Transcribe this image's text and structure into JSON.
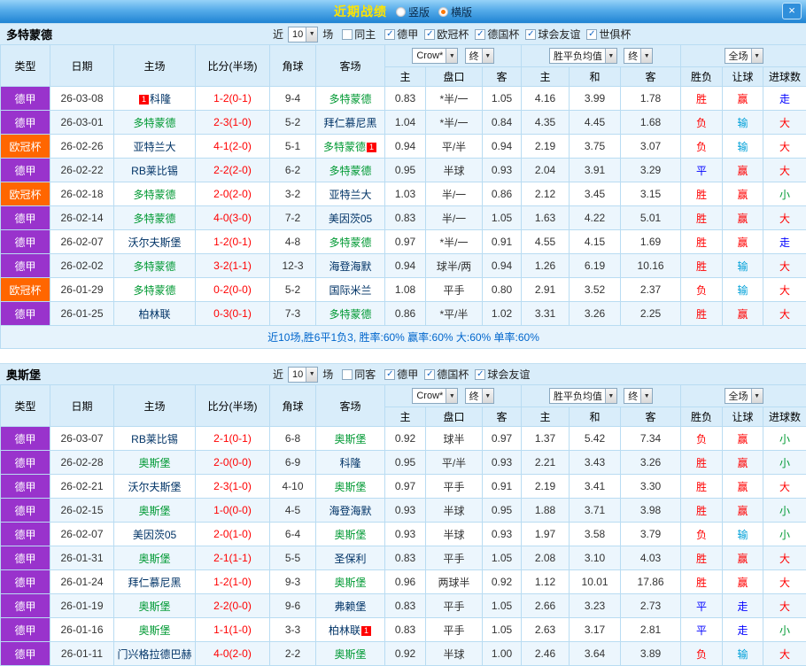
{
  "titlebar": {
    "title": "近期战绩",
    "radio_vertical": "竖版",
    "radio_horizontal": "横版",
    "close_label": "×"
  },
  "labels": {
    "near": "近",
    "games": "场"
  },
  "headers": {
    "type": "类型",
    "date": "日期",
    "home": "主场",
    "score": "比分(半场)",
    "corner": "角球",
    "away": "客场",
    "odds_home": "主",
    "odds_line": "盘口",
    "odds_away": "客",
    "ep_home": "主",
    "ep_draw": "和",
    "ep_away": "客",
    "wdl": "胜负",
    "handicap": "让球",
    "goals": "进球数",
    "company_select": "Crow*",
    "final_select": "终",
    "europe_select": "胜平负均值",
    "scope_select": "全场"
  },
  "league_colors": {
    "德甲": "#9933cc",
    "欧冠杯": "#ff6600"
  },
  "team_colors": {
    "self": "#009933",
    "opponent": "#003366"
  },
  "result_colors": {
    "胜": "#ff0000",
    "平": "#0000ff",
    "负": "#ff0000",
    "赢": "#ff0000",
    "输": "#00a0d8",
    "走": "#0000ff",
    "大": "#ff0000",
    "小": "#009933"
  },
  "sections": [
    {
      "team": "多特蒙德",
      "filter": {
        "count": "10",
        "same_label": "同主",
        "same_checked": false,
        "leagues": [
          "德甲",
          "欧冠杯",
          "德国杯",
          "球会友谊",
          "世俱杯"
        ]
      },
      "summary": "近10场,胜6平1负3, 胜率:60% 赢率:60% 大:60% 单率:60%",
      "rows": [
        {
          "league": "德甲",
          "date": "26-03-08",
          "home": {
            "name": "科隆",
            "self": false,
            "badge": "1",
            "badge_pos": "before"
          },
          "score": "1-2(0-1)",
          "corner": "9-4",
          "away": {
            "name": "多特蒙德",
            "self": true
          },
          "handicap": [
            "0.83",
            "*半/一",
            "1.05"
          ],
          "europe": [
            "4.16",
            "3.99",
            "1.78"
          ],
          "results": [
            "胜",
            "赢",
            "走"
          ]
        },
        {
          "league": "德甲",
          "date": "26-03-01",
          "home": {
            "name": "多特蒙德",
            "self": true
          },
          "score": "2-3(1-0)",
          "corner": "5-2",
          "away": {
            "name": "拜仁慕尼黑",
            "self": false
          },
          "handicap": [
            "1.04",
            "*半/一",
            "0.84"
          ],
          "europe": [
            "4.35",
            "4.45",
            "1.68"
          ],
          "results": [
            "负",
            "输",
            "大"
          ]
        },
        {
          "league": "欧冠杯",
          "date": "26-02-26",
          "home": {
            "name": "亚特兰大",
            "self": false
          },
          "score": "4-1(2-0)",
          "corner": "5-1",
          "away": {
            "name": "多特蒙德",
            "self": true,
            "badge": "1",
            "badge_pos": "after"
          },
          "handicap": [
            "0.94",
            "平/半",
            "0.94"
          ],
          "europe": [
            "2.19",
            "3.75",
            "3.07"
          ],
          "results": [
            "负",
            "输",
            "大"
          ]
        },
        {
          "league": "德甲",
          "date": "26-02-22",
          "home": {
            "name": "RB莱比锡",
            "self": false
          },
          "score": "2-2(2-0)",
          "corner": "6-2",
          "away": {
            "name": "多特蒙德",
            "self": true
          },
          "handicap": [
            "0.95",
            "半球",
            "0.93"
          ],
          "europe": [
            "2.04",
            "3.91",
            "3.29"
          ],
          "results": [
            "平",
            "赢",
            "大"
          ]
        },
        {
          "league": "欧冠杯",
          "date": "26-02-18",
          "home": {
            "name": "多特蒙德",
            "self": true
          },
          "score": "2-0(2-0)",
          "corner": "3-2",
          "away": {
            "name": "亚特兰大",
            "self": false
          },
          "handicap": [
            "1.03",
            "半/一",
            "0.86"
          ],
          "europe": [
            "2.12",
            "3.45",
            "3.15"
          ],
          "results": [
            "胜",
            "赢",
            "小"
          ]
        },
        {
          "league": "德甲",
          "date": "26-02-14",
          "home": {
            "name": "多特蒙德",
            "self": true
          },
          "score": "4-0(3-0)",
          "corner": "7-2",
          "away": {
            "name": "美因茨05",
            "self": false
          },
          "handicap": [
            "0.83",
            "半/一",
            "1.05"
          ],
          "europe": [
            "1.63",
            "4.22",
            "5.01"
          ],
          "results": [
            "胜",
            "赢",
            "大"
          ]
        },
        {
          "league": "德甲",
          "date": "26-02-07",
          "home": {
            "name": "沃尔夫斯堡",
            "self": false
          },
          "score": "1-2(0-1)",
          "corner": "4-8",
          "away": {
            "name": "多特蒙德",
            "self": true
          },
          "handicap": [
            "0.97",
            "*半/一",
            "0.91"
          ],
          "europe": [
            "4.55",
            "4.15",
            "1.69"
          ],
          "results": [
            "胜",
            "赢",
            "走"
          ]
        },
        {
          "league": "德甲",
          "date": "26-02-02",
          "home": {
            "name": "多特蒙德",
            "self": true
          },
          "score": "3-2(1-1)",
          "corner": "12-3",
          "away": {
            "name": "海登海默",
            "self": false
          },
          "handicap": [
            "0.94",
            "球半/两",
            "0.94"
          ],
          "europe": [
            "1.26",
            "6.19",
            "10.16"
          ],
          "results": [
            "胜",
            "输",
            "大"
          ]
        },
        {
          "league": "欧冠杯",
          "date": "26-01-29",
          "home": {
            "name": "多特蒙德",
            "self": true
          },
          "score": "0-2(0-0)",
          "corner": "5-2",
          "away": {
            "name": "国际米兰",
            "self": false
          },
          "handicap": [
            "1.08",
            "平手",
            "0.80"
          ],
          "europe": [
            "2.91",
            "3.52",
            "2.37"
          ],
          "results": [
            "负",
            "输",
            "大"
          ]
        },
        {
          "league": "德甲",
          "date": "26-01-25",
          "home": {
            "name": "柏林联",
            "self": false
          },
          "score": "0-3(0-1)",
          "corner": "7-3",
          "away": {
            "name": "多特蒙德",
            "self": true
          },
          "handicap": [
            "0.86",
            "*平/半",
            "1.02"
          ],
          "europe": [
            "3.31",
            "3.26",
            "2.25"
          ],
          "results": [
            "胜",
            "赢",
            "大"
          ]
        }
      ]
    },
    {
      "team": "奥斯堡",
      "filter": {
        "count": "10",
        "same_label": "同客",
        "same_checked": false,
        "leagues": [
          "德甲",
          "德国杯",
          "球会友谊"
        ]
      },
      "rows": [
        {
          "league": "德甲",
          "date": "26-03-07",
          "home": {
            "name": "RB莱比锡",
            "self": false
          },
          "score": "2-1(0-1)",
          "corner": "6-8",
          "away": {
            "name": "奥斯堡",
            "self": true
          },
          "handicap": [
            "0.92",
            "球半",
            "0.97"
          ],
          "europe": [
            "1.37",
            "5.42",
            "7.34"
          ],
          "results": [
            "负",
            "赢",
            "小"
          ]
        },
        {
          "league": "德甲",
          "date": "26-02-28",
          "home": {
            "name": "奥斯堡",
            "self": true
          },
          "score": "2-0(0-0)",
          "corner": "6-9",
          "away": {
            "name": "科隆",
            "self": false
          },
          "handicap": [
            "0.95",
            "平/半",
            "0.93"
          ],
          "europe": [
            "2.21",
            "3.43",
            "3.26"
          ],
          "results": [
            "胜",
            "赢",
            "小"
          ]
        },
        {
          "league": "德甲",
          "date": "26-02-21",
          "home": {
            "name": "沃尔夫斯堡",
            "self": false
          },
          "score": "2-3(1-0)",
          "corner": "4-10",
          "away": {
            "name": "奥斯堡",
            "self": true
          },
          "handicap": [
            "0.97",
            "平手",
            "0.91"
          ],
          "europe": [
            "2.19",
            "3.41",
            "3.30"
          ],
          "results": [
            "胜",
            "赢",
            "大"
          ]
        },
        {
          "league": "德甲",
          "date": "26-02-15",
          "home": {
            "name": "奥斯堡",
            "self": true
          },
          "score": "1-0(0-0)",
          "corner": "4-5",
          "away": {
            "name": "海登海默",
            "self": false
          },
          "handicap": [
            "0.93",
            "半球",
            "0.95"
          ],
          "europe": [
            "1.88",
            "3.71",
            "3.98"
          ],
          "results": [
            "胜",
            "赢",
            "小"
          ]
        },
        {
          "league": "德甲",
          "date": "26-02-07",
          "home": {
            "name": "美因茨05",
            "self": false
          },
          "score": "2-0(1-0)",
          "corner": "6-4",
          "away": {
            "name": "奥斯堡",
            "self": true
          },
          "handicap": [
            "0.93",
            "半球",
            "0.93"
          ],
          "europe": [
            "1.97",
            "3.58",
            "3.79"
          ],
          "results": [
            "负",
            "输",
            "小"
          ]
        },
        {
          "league": "德甲",
          "date": "26-01-31",
          "home": {
            "name": "奥斯堡",
            "self": true
          },
          "score": "2-1(1-1)",
          "corner": "5-5",
          "away": {
            "name": "圣保利",
            "self": false
          },
          "handicap": [
            "0.83",
            "平手",
            "1.05"
          ],
          "europe": [
            "2.08",
            "3.10",
            "4.03"
          ],
          "results": [
            "胜",
            "赢",
            "大"
          ]
        },
        {
          "league": "德甲",
          "date": "26-01-24",
          "home": {
            "name": "拜仁慕尼黑",
            "self": false
          },
          "score": "1-2(1-0)",
          "corner": "9-3",
          "away": {
            "name": "奥斯堡",
            "self": true
          },
          "handicap": [
            "0.96",
            "两球半",
            "0.92"
          ],
          "europe": [
            "1.12",
            "10.01",
            "17.86"
          ],
          "results": [
            "胜",
            "赢",
            "大"
          ]
        },
        {
          "league": "德甲",
          "date": "26-01-19",
          "home": {
            "name": "奥斯堡",
            "self": true
          },
          "score": "2-2(0-0)",
          "corner": "9-6",
          "away": {
            "name": "弗赖堡",
            "self": false
          },
          "handicap": [
            "0.83",
            "平手",
            "1.05"
          ],
          "europe": [
            "2.66",
            "3.23",
            "2.73"
          ],
          "results": [
            "平",
            "走",
            "大"
          ]
        },
        {
          "league": "德甲",
          "date": "26-01-16",
          "home": {
            "name": "奥斯堡",
            "self": true
          },
          "score": "1-1(1-0)",
          "corner": "3-3",
          "away": {
            "name": "柏林联",
            "self": false,
            "badge": "1",
            "badge_pos": "after"
          },
          "handicap": [
            "0.83",
            "平手",
            "1.05"
          ],
          "europe": [
            "2.63",
            "3.17",
            "2.81"
          ],
          "results": [
            "平",
            "走",
            "小"
          ]
        },
        {
          "league": "德甲",
          "date": "26-01-11",
          "home": {
            "name": "门兴格拉德巴赫",
            "self": false
          },
          "score": "4-0(2-0)",
          "corner": "2-2",
          "away": {
            "name": "奥斯堡",
            "self": true
          },
          "handicap": [
            "0.92",
            "半球",
            "1.00"
          ],
          "europe": [
            "2.46",
            "3.64",
            "3.89"
          ],
          "results": [
            "负",
            "输",
            "大"
          ]
        }
      ]
    }
  ]
}
